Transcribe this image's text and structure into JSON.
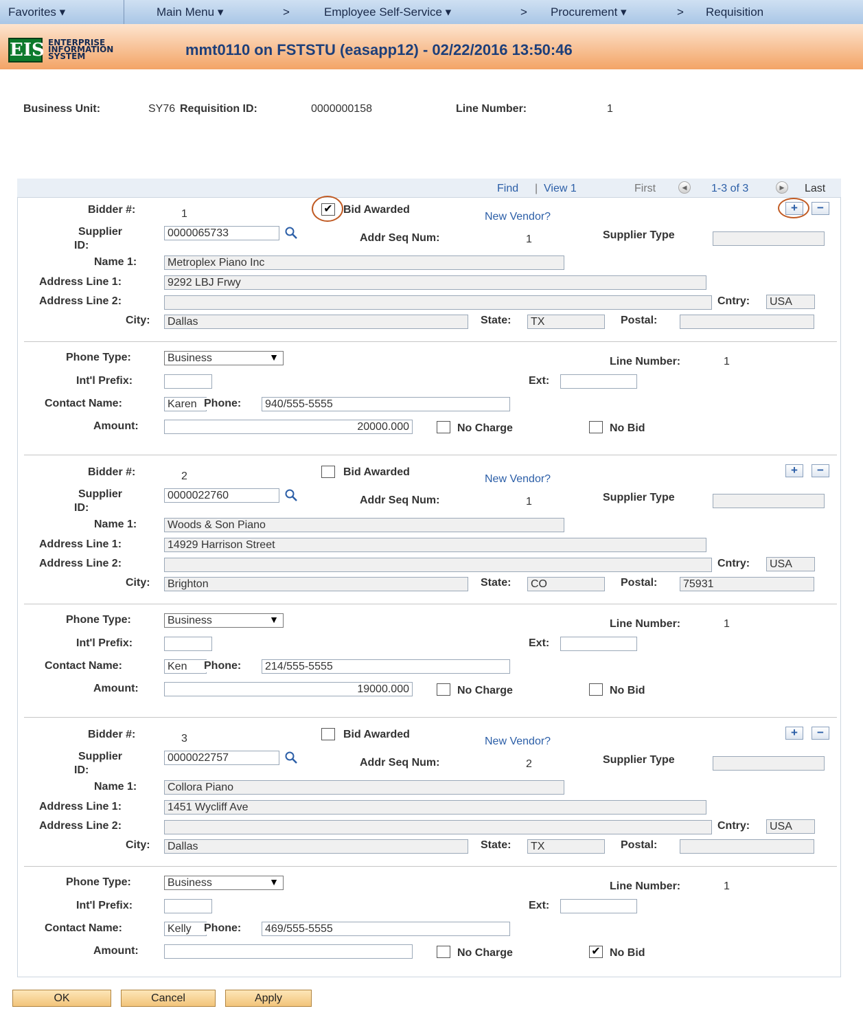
{
  "nav": {
    "favorites": "Favorites ▾",
    "main_menu": "Main Menu ▾",
    "gt1": ">",
    "ess": "Employee Self-Service ▾",
    "gt2": ">",
    "procurement": "Procurement ▾",
    "gt3": ">",
    "requisition": "Requisition"
  },
  "header": {
    "logo": "EIS",
    "logo_line1": "ENTERPRISE",
    "logo_line2": "INFORMATION",
    "logo_line3": "SYSTEM",
    "title": "mmt0110 on FSTSTU (easapp12) - 02/22/2016 13:50:46"
  },
  "summary": {
    "bu_label": "Business Unit:",
    "bu_value": "SY76",
    "req_label": "Requisition ID:",
    "req_value": "0000000158",
    "line_label": "Line Number:",
    "line_value": "1"
  },
  "grid": {
    "find": "Find",
    "pipe": "|",
    "view": "View 1",
    "first": "First",
    "range": "1-3 of 3",
    "last": "Last"
  },
  "labels": {
    "bidder": "Bidder #:",
    "bid_awarded": "Bid Awarded",
    "new_vendor": "New Vendor?",
    "supplier": "Supplier",
    "supplier2": "ID:",
    "addr_seq": "Addr Seq Num:",
    "supplier_type": "Supplier Type",
    "name1": "Name 1:",
    "addr1": "Address Line 1:",
    "addr2": "Address Line 2:",
    "cntry": "Cntry:",
    "city": "City:",
    "state": "State:",
    "postal": "Postal:",
    "phone_type": "Phone Type:",
    "line_number": "Line Number:",
    "intl": "Int'l Prefix:",
    "ext": "Ext:",
    "contact": "Contact Name:",
    "phone": "Phone:",
    "amount": "Amount:",
    "no_charge": "No Charge",
    "no_bid": "No Bid",
    "plus": "+",
    "minus": "−"
  },
  "bidders": [
    {
      "num": "1",
      "awarded": "✔",
      "supplier_id": "0000065733",
      "addr_seq": "1",
      "supplier_type": "",
      "name1": "Metroplex Piano Inc",
      "addr1": "9292 LBJ Frwy",
      "addr2": "",
      "cntry": "USA",
      "city": "Dallas",
      "state": "TX",
      "postal": "",
      "phone_type": "Business",
      "line_number": "1",
      "intl": "",
      "ext": "",
      "contact": "Karen",
      "phone": "940/555-5555",
      "amount": "20000.000",
      "no_charge": "",
      "no_bid": ""
    },
    {
      "num": "2",
      "awarded": "",
      "supplier_id": "0000022760",
      "addr_seq": "1",
      "supplier_type": "",
      "name1": "Woods & Son Piano",
      "addr1": "14929 Harrison Street",
      "addr2": "",
      "cntry": "USA",
      "city": "Brighton",
      "state": "CO",
      "postal": "75931",
      "phone_type": "Business",
      "line_number": "1",
      "intl": "",
      "ext": "",
      "contact": "Ken",
      "phone": "214/555-5555",
      "amount": "19000.000",
      "no_charge": "",
      "no_bid": ""
    },
    {
      "num": "3",
      "awarded": "",
      "supplier_id": "0000022757",
      "addr_seq": "2",
      "supplier_type": "",
      "name1": "Collora Piano",
      "addr1": "1451 Wycliff Ave",
      "addr2": "",
      "cntry": "USA",
      "city": "Dallas",
      "state": "TX",
      "postal": "",
      "phone_type": "Business",
      "line_number": "1",
      "intl": "",
      "ext": "",
      "contact": "Kelly",
      "phone": "469/555-5555",
      "amount": "",
      "no_charge": "",
      "no_bid": "✔"
    }
  ],
  "buttons": {
    "ok": "OK",
    "cancel": "Cancel",
    "apply": "Apply"
  },
  "colors": {
    "nav_bg": "#b9d1ec",
    "header_bg": "#f3a466",
    "title": "#1d3f7a",
    "link": "#2b5ea7",
    "highlight_ring": "#c05a23"
  },
  "icons": {
    "lookup": "magnifier-icon",
    "prev": "prev-arrow-icon",
    "next": "next-arrow-icon"
  }
}
